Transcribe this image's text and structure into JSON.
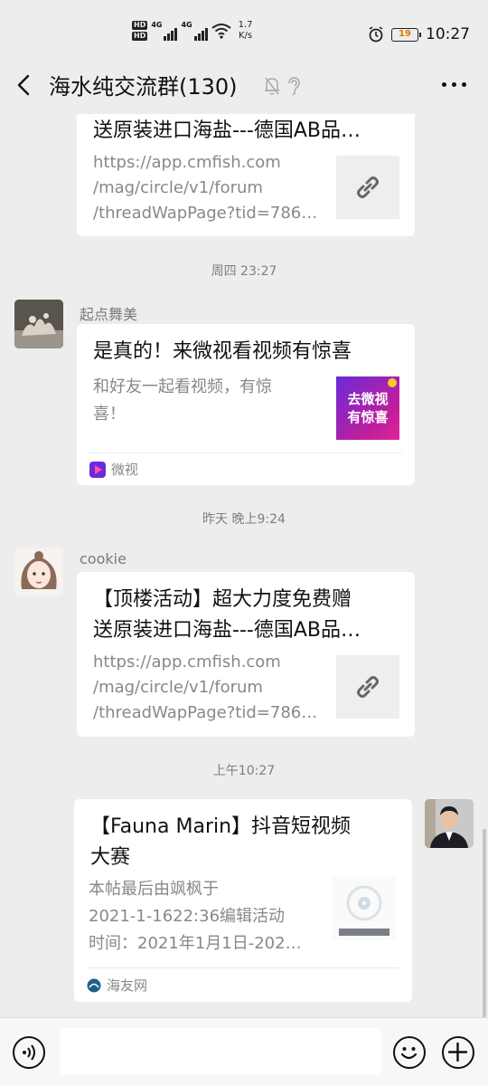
{
  "status_bar": {
    "net1": "4G",
    "net2": "4G",
    "speed_value": "1.7",
    "speed_unit": "K/s",
    "battery": "19",
    "time": "10:27"
  },
  "header": {
    "title": "海水纯交流群(130)"
  },
  "messages": [
    {
      "title_lines": [
        "送原装进口海盐---德国AB品…"
      ],
      "desc_lines": [
        "https://app.cmfish.com",
        "/mag/circle/v1/forum",
        "/threadWapPage?tid=786…"
      ]
    },
    {
      "timestamp": "周四 23:27"
    },
    {
      "sender": "起点舞美",
      "title_lines": [
        "是真的！来微视看视频有惊喜"
      ],
      "desc_lines": [
        "和好友一起看视频，有惊",
        "喜！"
      ],
      "thumb_text_lines": [
        "去微视",
        "有惊喜"
      ],
      "source": "微视"
    },
    {
      "timestamp": "昨天 晚上9:24"
    },
    {
      "sender": "cookie",
      "title_lines": [
        "【顶楼活动】超大力度免费赠",
        "送原装进口海盐---德国AB品…"
      ],
      "desc_lines": [
        "https://app.cmfish.com",
        "/mag/circle/v1/forum",
        "/threadWapPage?tid=786…"
      ]
    },
    {
      "timestamp": "上午10:27"
    },
    {
      "title_lines": [
        "【Fauna Marin】抖音短视频",
        "大赛"
      ],
      "desc_lines": [
        "本帖最后由飒枫于",
        "2021-1-1622:36编辑活动",
        "时间：2021年1月1日-202…"
      ],
      "source": "海友网"
    }
  ],
  "colors": {
    "background": "#ededed",
    "card": "#ffffff",
    "weishi_purple": "#6a2bd9",
    "weishi_pink": "#e0249a"
  }
}
